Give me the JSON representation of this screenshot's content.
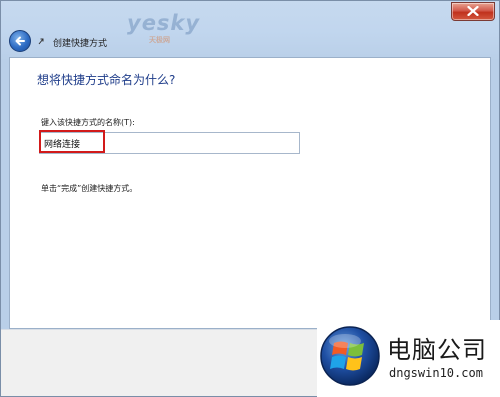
{
  "watermark": {
    "text": "yesky",
    "sub": "天极网"
  },
  "titlebar": {
    "close_icon": "close-icon"
  },
  "nav": {
    "back_icon": "back-arrow-icon",
    "item_icon": "shortcut-icon",
    "title": "创建快捷方式"
  },
  "main": {
    "heading": "想将快捷方式命名为什么?",
    "field_label": "键入该快捷方式的名称(T):",
    "name_value": "网络连接",
    "hint": "单击“完成”创建快捷方式。"
  },
  "logo": {
    "icon": "windows-logo-icon",
    "title": "电脑公司",
    "url": "dngswin10.com"
  },
  "colors": {
    "heading": "#1f3d8a",
    "highlight": "#d21a1a",
    "chrome": "#c1d6ee"
  }
}
